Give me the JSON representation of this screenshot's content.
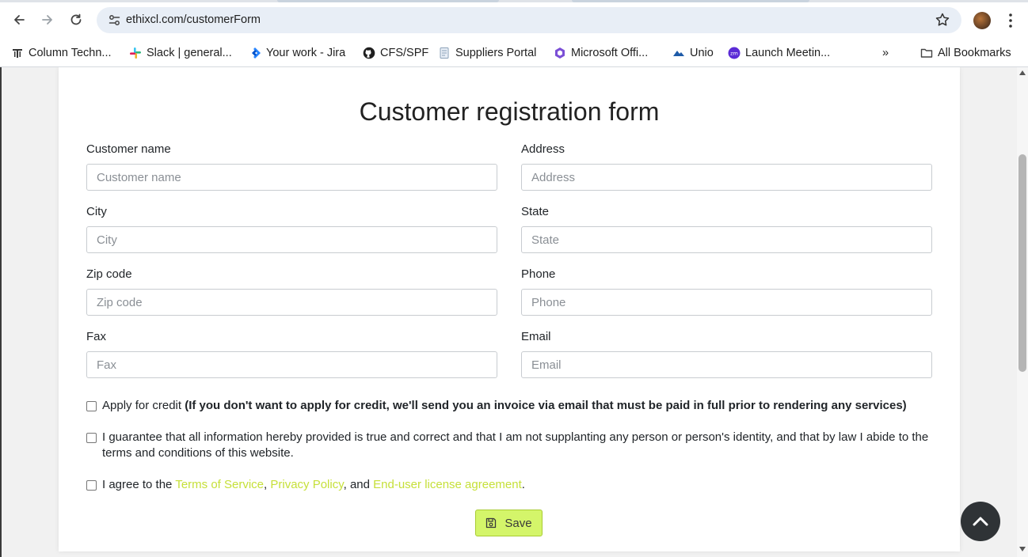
{
  "browser": {
    "url": "ethixcl.com/customerForm",
    "bookmarks": [
      {
        "label": "Column Techn...",
        "icon": "column-logo-icon"
      },
      {
        "label": "Slack | general...",
        "icon": "slack-icon"
      },
      {
        "label": "Your work - Jira",
        "icon": "jira-icon"
      },
      {
        "label": "CFS/SPF",
        "icon": "github-icon"
      },
      {
        "label": "Suppliers Portal",
        "icon": "document-icon"
      },
      {
        "label": "Microsoft Offi...",
        "icon": "microsoft-office-icon"
      },
      {
        "label": "Unio",
        "icon": "unio-icon"
      },
      {
        "label": "Launch Meetin...",
        "icon": "zoom-icon"
      }
    ],
    "overflow_label": "»",
    "all_bookmarks_label": "All Bookmarks"
  },
  "form": {
    "title": "Customer registration form",
    "fields": [
      {
        "label": "Customer name",
        "placeholder": "Customer name"
      },
      {
        "label": "Address",
        "placeholder": "Address"
      },
      {
        "label": "City",
        "placeholder": "City"
      },
      {
        "label": "State",
        "placeholder": "State"
      },
      {
        "label": "Zip code",
        "placeholder": "Zip code"
      },
      {
        "label": "Phone",
        "placeholder": "Phone"
      },
      {
        "label": "Fax",
        "placeholder": "Fax"
      },
      {
        "label": "Email",
        "placeholder": "Email"
      }
    ],
    "credit": {
      "label": "Apply for credit",
      "note": "(If you don't want to apply for credit, we'll send you an invoice via email that must be paid in full prior to rendering any services)"
    },
    "guarantee_text": "I guarantee that all information hereby provided is true and correct and that I am not supplanting any person or person's identity, and that by law I abide to the terms and conditions of this website.",
    "agree": {
      "prefix": "I agree to the",
      "terms_link": "Terms of Service",
      "sep1": ",",
      "privacy_link": "Privacy Policy",
      "sep2": ", and",
      "eula_link": "End-user license agreement",
      "suffix": "."
    },
    "save_label": "Save"
  },
  "colors": {
    "accent_link": "#c6e03a",
    "save_button_bg": "#d4f56a",
    "to_top_bg": "#2f3336"
  }
}
